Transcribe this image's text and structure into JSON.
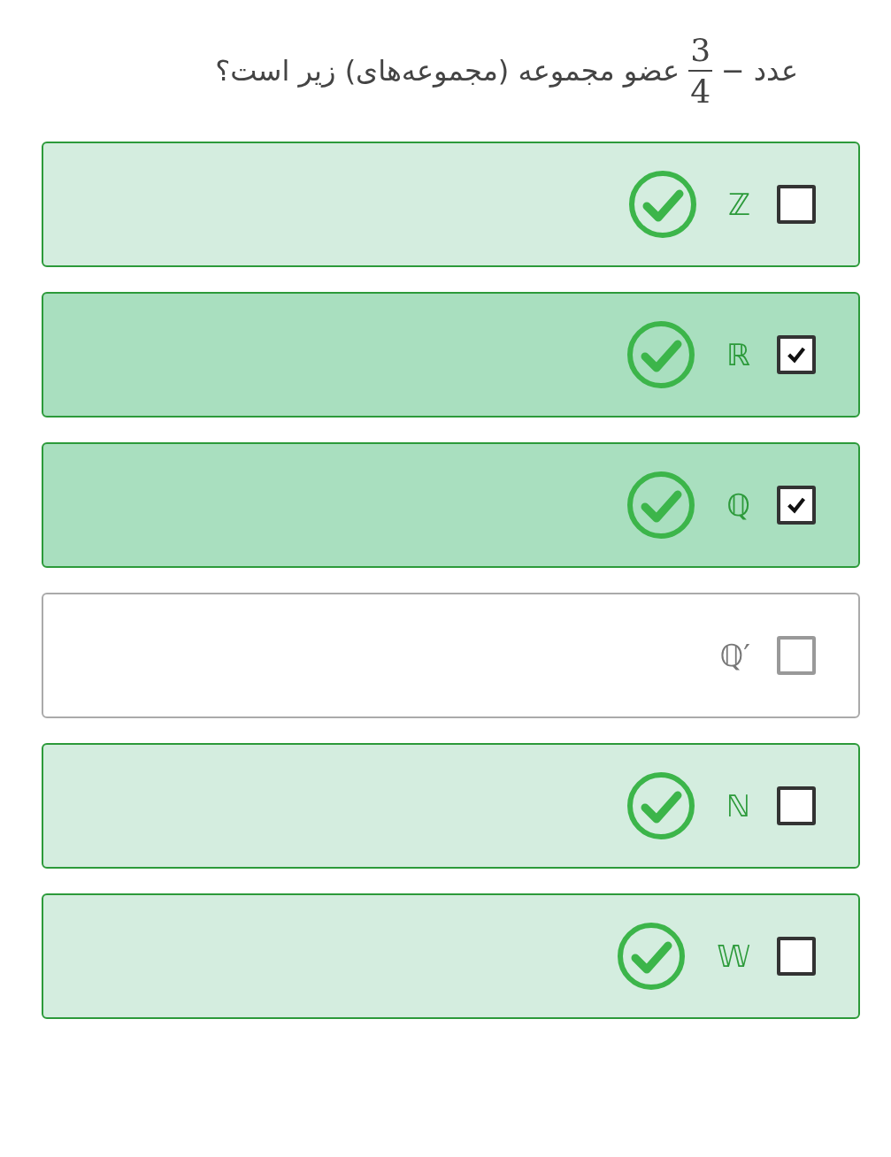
{
  "question": {
    "before": "عدد",
    "sign": "−",
    "numerator": "3",
    "denominator": "4",
    "after": "عضو مجموعه (مجموعه‌های) زیر است؟"
  },
  "options": [
    {
      "label": "ℤ",
      "checked": false,
      "correct": true
    },
    {
      "label": "ℝ",
      "checked": true,
      "correct": true
    },
    {
      "label": "ℚ",
      "checked": true,
      "correct": true
    },
    {
      "label": "ℚ′",
      "checked": false,
      "correct": false
    },
    {
      "label": "ℕ",
      "checked": false,
      "correct": true
    },
    {
      "label": "𝕎",
      "checked": false,
      "correct": true
    }
  ]
}
